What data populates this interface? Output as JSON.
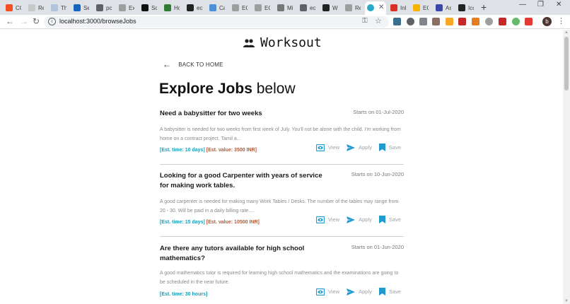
{
  "browser": {
    "tabs": [
      {
        "title": "CC",
        "color": "#f25022"
      },
      {
        "title": "Re",
        "color": "#c8c8c8"
      },
      {
        "title": "Th",
        "color": "#b0c4de"
      },
      {
        "title": "Se",
        "color": "#1565c0"
      },
      {
        "title": "pc",
        "color": "#5f6368"
      },
      {
        "title": "Ex",
        "color": "#9e9e9e"
      },
      {
        "title": "Sc",
        "color": "#111111"
      },
      {
        "title": "Hc",
        "color": "#2e7d32"
      },
      {
        "title": "eo",
        "color": "#222222"
      },
      {
        "title": "Ca",
        "color": "#4a90d9"
      },
      {
        "title": "EC",
        "color": "#9e9e9e"
      },
      {
        "title": "EC",
        "color": "#9e9e9e"
      },
      {
        "title": "Mi",
        "color": "#777777"
      },
      {
        "title": "eo",
        "color": "#5f6368"
      },
      {
        "title": "Wi",
        "color": "#222222"
      },
      {
        "title": "Re",
        "color": "#9e9e9e"
      },
      {
        "title": "",
        "color": "#29a9c7",
        "active": true
      },
      {
        "title": "Inl",
        "color": "#d93025"
      },
      {
        "title": "EC",
        "color": "#f4b400"
      },
      {
        "title": "As",
        "color": "#3949ab"
      },
      {
        "title": "Icc",
        "color": "#222222"
      }
    ],
    "close_glyph": "✕",
    "new_tab_glyph": "+",
    "url": "localhost:3000/browseJobs",
    "profile_initial": "b"
  },
  "page": {
    "brand": "Worksout",
    "back_label": "BACK TO HOME",
    "heading_bold": "Explore Jobs",
    "heading_light": "below",
    "action_labels": {
      "view": "View",
      "apply": "Apply",
      "save": "Save"
    },
    "colors": {
      "time": "#1f9bb5",
      "value": "#c0562b",
      "icon": "#1f9bd1"
    },
    "jobs": [
      {
        "title": "Need a babysitter for two weeks",
        "date": "Starts on 01-Jul-2020",
        "description": "A babysitter is needed for two weeks from first week of July. You'll not be alone with the child. I'm working from home on a contract project. Tamil a...",
        "est_time": "[Est. time: 10 days]",
        "est_value": "[Est. value: 3500 INR]"
      },
      {
        "title": "Looking for a good Carpenter with years of service for making work tables.",
        "date": "Starts on 10-Jun-2020",
        "description": "A good carpenter is needed for making many Work Tables / Desks. The number of the tables may range from 20 - 30. Will be paid in a daily billing rate....",
        "est_time": "[Est. time: 15 days]",
        "est_value": "[Est. value: 10500 INR]"
      },
      {
        "title": "Are there any tutors available for high school mathematics?",
        "date": "Starts on 01-Jun-2020",
        "description": "A good mathematics tutor is required for learning high school mathematics and the examinations are going to be scheduled in the near future.",
        "est_time": "[Est. time: 30 hours]",
        "est_value": ""
      }
    ]
  }
}
